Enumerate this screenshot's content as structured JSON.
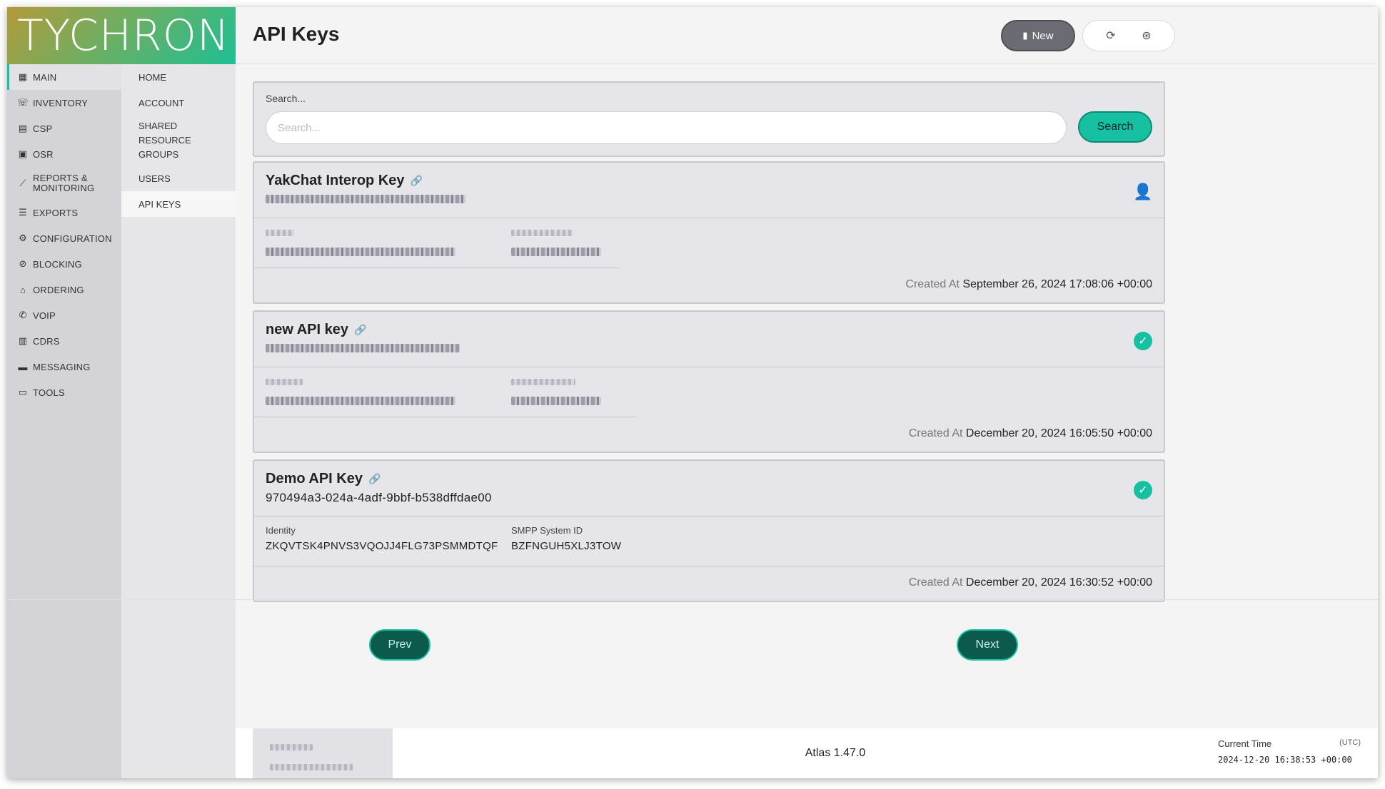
{
  "brand": {
    "logo_text": "TYCHRON"
  },
  "nav_primary": [
    {
      "label": "MAIN",
      "icon": "building-icon",
      "glyph": "▦"
    },
    {
      "label": "INVENTORY",
      "icon": "phone-list-icon",
      "glyph": "☏"
    },
    {
      "label": "CSP",
      "icon": "message-list-icon",
      "glyph": "▤"
    },
    {
      "label": "OSR",
      "icon": "gear-box-icon",
      "glyph": "▣"
    },
    {
      "label": "REPORTS & MONITORING",
      "icon": "line-chart-icon",
      "glyph": "⟋"
    },
    {
      "label": "EXPORTS",
      "icon": "stack-icon",
      "glyph": "☰"
    },
    {
      "label": "CONFIGURATION",
      "icon": "config-icon",
      "glyph": "⚙"
    },
    {
      "label": "BLOCKING",
      "icon": "user-block-icon",
      "glyph": "⊘"
    },
    {
      "label": "ORDERING",
      "icon": "basket-icon",
      "glyph": "⌂"
    },
    {
      "label": "VOIP",
      "icon": "phone-icon",
      "glyph": "✆"
    },
    {
      "label": "CDRS",
      "icon": "grid-icon",
      "glyph": "▥"
    },
    {
      "label": "MESSAGING",
      "icon": "chat-icon",
      "glyph": "▬"
    },
    {
      "label": "TOOLS",
      "icon": "briefcase-icon",
      "glyph": "▭"
    }
  ],
  "nav_secondary": [
    {
      "label": "HOME"
    },
    {
      "label": "ACCOUNT"
    },
    {
      "label": "SHARED RESOURCE GROUPS"
    },
    {
      "label": "USERS"
    },
    {
      "label": "API KEYS"
    }
  ],
  "header": {
    "title": "API Keys",
    "new_label": "New",
    "refresh_glyph": "⟳",
    "settings_glyph": "⊛"
  },
  "search": {
    "label": "Search...",
    "placeholder": "Search...",
    "button_label": "Search"
  },
  "keys": [
    {
      "name": "YakChat Interop Key",
      "status_icon": "user-check-icon",
      "status_glyph": "👤",
      "created_label": "Created At",
      "created_value": "September 26, 2024 17:08:06 +00:00"
    },
    {
      "name": "new API key",
      "status_icon": "check-circle-icon",
      "status_glyph": "✓",
      "created_label": "Created At",
      "created_value": "December 20, 2024 16:05:50 +00:00"
    },
    {
      "name": "Demo API Key",
      "key": "970494a3-024a-4adf-9bbf-b538dffdae00",
      "identity_label": "Identity",
      "identity_value": "ZKQVTSK4PNVS3VQOJJ4FLG73PSMMDTQF",
      "smpp_label": "SMPP System ID",
      "smpp_value": "BZFNGUH5XLJ3TOW",
      "status_icon": "check-circle-icon",
      "status_glyph": "✓",
      "created_label": "Created At",
      "created_value": "December 20, 2024 16:30:52 +00:00"
    }
  ],
  "pager": {
    "prev": "Prev",
    "next": "Next"
  },
  "footer": {
    "version": "Atlas 1.47.0",
    "time_label": "Current Time",
    "time_zone": "(UTC)",
    "time_value": "2024-12-20 16:38:53 +00:00"
  },
  "colors": {
    "accent": "#17c0a0",
    "pager": "#0b5a4c",
    "new_button": "#6b6b74"
  }
}
